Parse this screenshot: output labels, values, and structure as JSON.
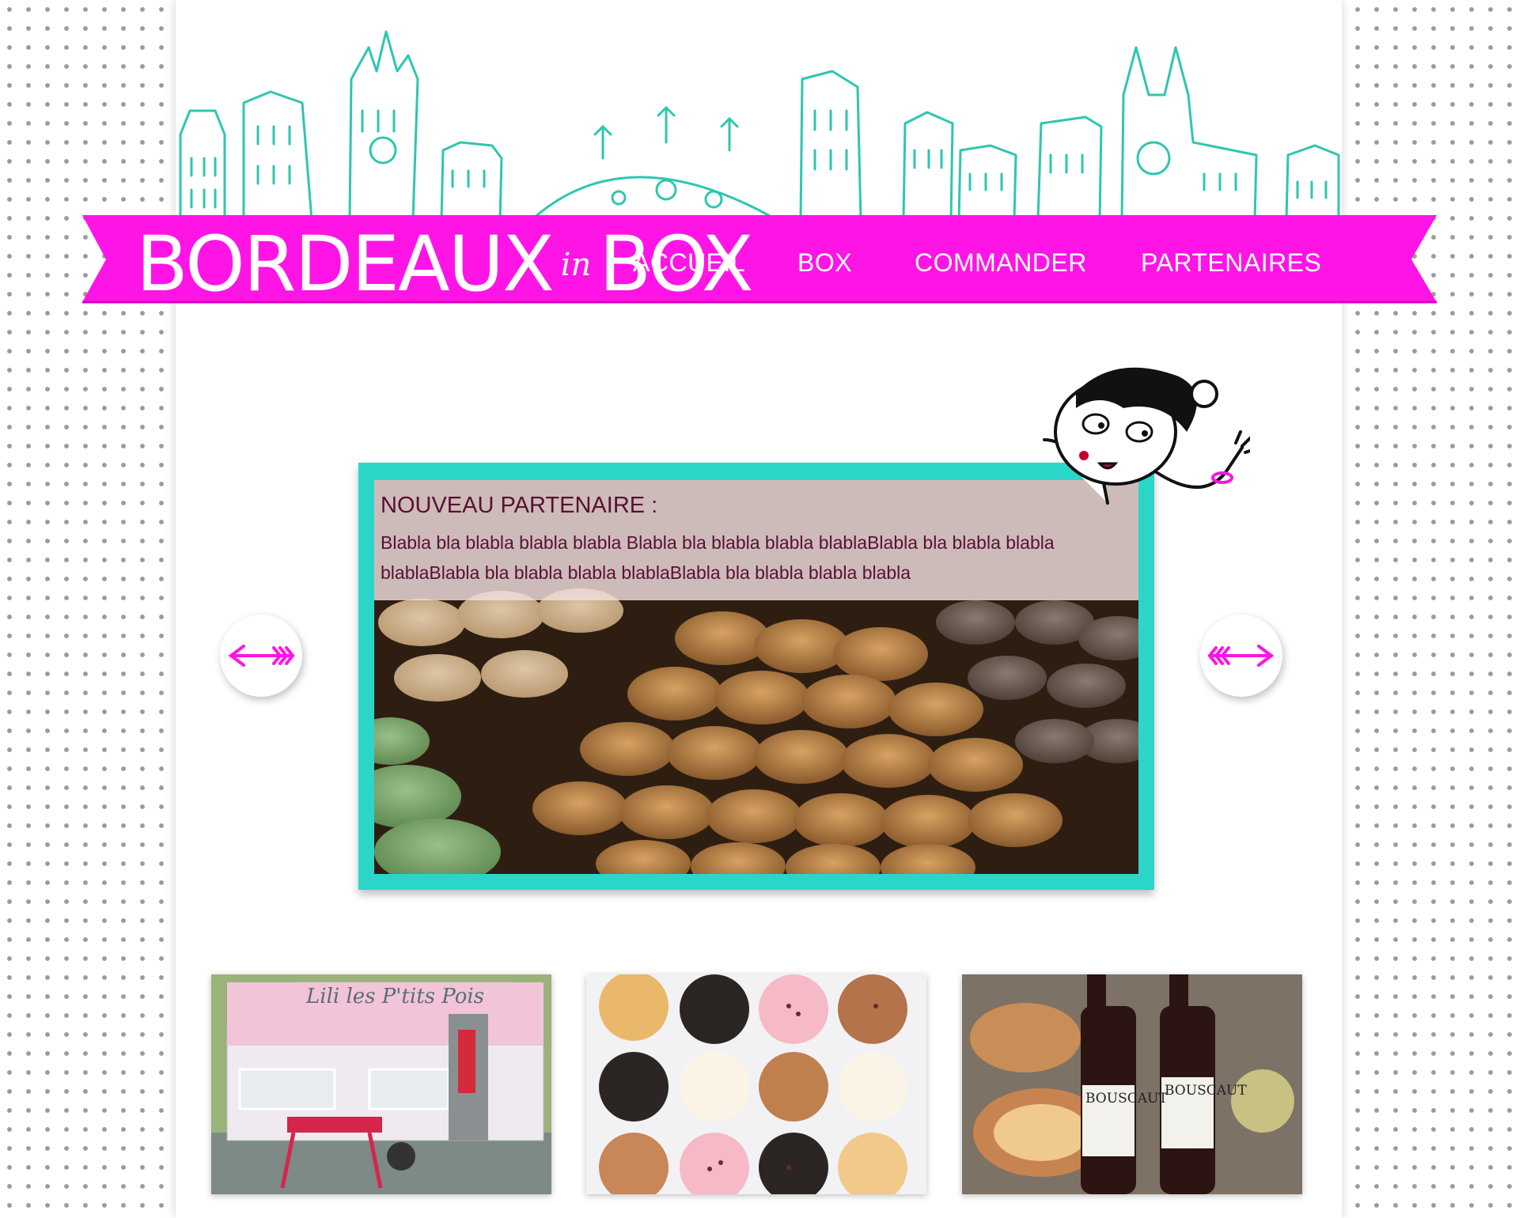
{
  "brand": {
    "logo_main_1": "BORDEAUX",
    "logo_small": "in",
    "logo_main_2": "BOX"
  },
  "nav": {
    "items": [
      {
        "label": "ACCUEIL"
      },
      {
        "label": "BOX"
      },
      {
        "label": "COMMANDER"
      },
      {
        "label": "PARTENAIRES"
      }
    ]
  },
  "slider": {
    "title": "NOUVEAU PARTENAIRE :",
    "text": "Blabla bla blabla blabla blabla Blabla bla blabla blabla blablaBlabla bla blabla blabla blablaBlabla bla blabla blabla blablaBlabla bla blabla blabla blabla",
    "image": "macarons-photo",
    "prev_icon": "arrow-left-icon",
    "next_icon": "arrow-right-icon"
  },
  "thumbnails": [
    {
      "image": "caravan-photo",
      "sign": "Lili les P'tits Pois"
    },
    {
      "image": "cupcakes-photo"
    },
    {
      "image": "wine-cheese-photo",
      "label_1": "BOUSCAUT",
      "label_2": "BOUSCAUT"
    }
  ],
  "colors": {
    "magenta": "#ff14e6",
    "teal": "#2bd6c8",
    "skyline": "#2ec6b0",
    "caption_text": "#5a1032"
  }
}
